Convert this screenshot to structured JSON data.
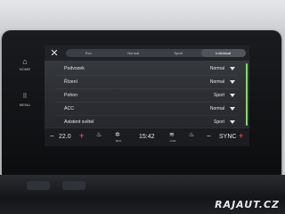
{
  "rail": {
    "home_label": "HOME",
    "menu_label": "MENU"
  },
  "tabs": [
    "Eco",
    "Normal",
    "Sport",
    "Individual"
  ],
  "active_tab": "Individual",
  "settings": [
    {
      "name": "Podvozek",
      "value": "Normal"
    },
    {
      "name": "Řízení",
      "value": "Normal"
    },
    {
      "name": "Pohon",
      "value": "Sport"
    },
    {
      "name": "ACC",
      "value": "Normal"
    },
    {
      "name": "Asistent světel",
      "value": "Sport"
    }
  ],
  "climate": {
    "left_temp": "22.0",
    "fan_label": "MFD",
    "time": "15:42",
    "airflow_label": "LOW",
    "sync_label": "SYNC"
  },
  "watermark": "RAJAUT.CZ",
  "colors": {
    "scroll_accent": "#7dde5a",
    "plus_red": "#ff2a3a"
  }
}
